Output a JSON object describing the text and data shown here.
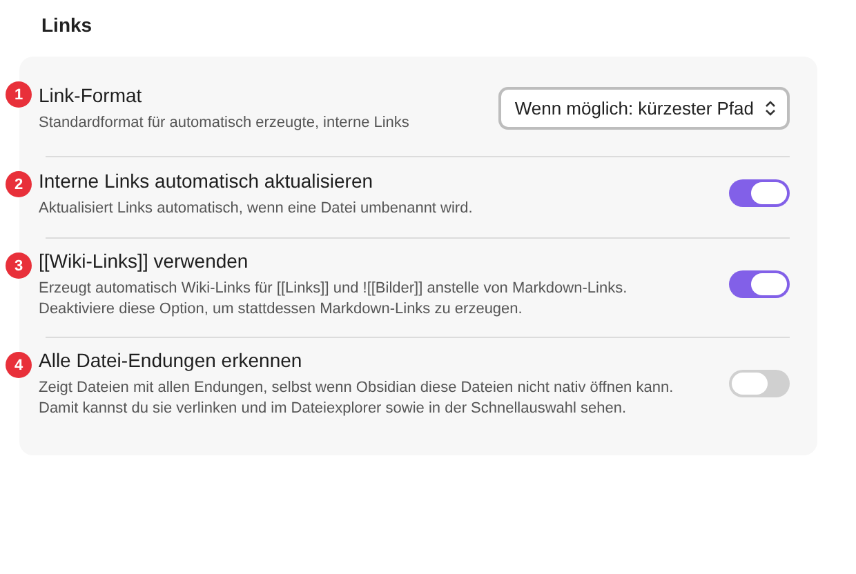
{
  "heading": "Links",
  "settings": [
    {
      "badge": "1",
      "title": "Link-Format",
      "description": "Standardformat für automatisch erzeugte, interne Links",
      "kind": "dropdown",
      "value": "Wenn möglich: kürzester Pfad"
    },
    {
      "badge": "2",
      "title": "Interne Links automatisch aktualisieren",
      "description": "Aktualisiert Links automatisch, wenn eine Datei umbenannt wird.",
      "kind": "toggle",
      "on": true
    },
    {
      "badge": "3",
      "title": "[[Wiki-Links]] verwenden",
      "description": "Erzeugt automatisch Wiki-Links für [[Links]] und ![[Bilder]] anstelle von Markdown-Links. Deaktiviere diese Option, um stattdessen Markdown-Links zu erzeugen.",
      "kind": "toggle",
      "on": true
    },
    {
      "badge": "4",
      "title": "Alle Datei-Endungen erkennen",
      "description": "Zeigt Dateien mit allen Endungen, selbst wenn Obsidian diese Dateien nicht nativ öffnen kann. Damit kannst du sie verlinken und im Dateiexplorer sowie in der Schnellauswahl sehen.",
      "kind": "toggle",
      "on": false
    }
  ]
}
